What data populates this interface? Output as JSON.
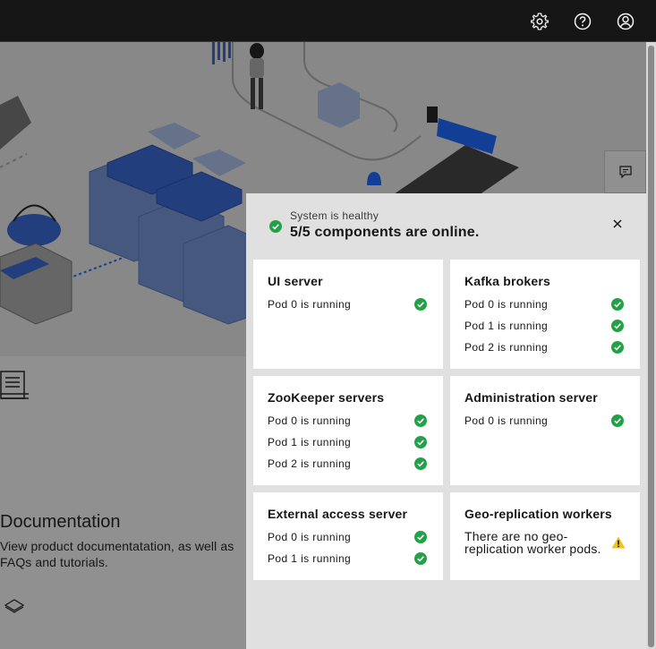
{
  "header": {
    "icons": [
      "settings-icon",
      "help-icon",
      "user-avatar-icon"
    ]
  },
  "background": {
    "documentation": {
      "title": "Documentation",
      "description": "View product documentatation, as well as FAQs and tutorials."
    }
  },
  "status_panel": {
    "subtitle": "System is healthy",
    "title": "5/5 components are online.",
    "colors": {
      "success": "#24a148",
      "warning": "#f1c21b"
    },
    "cards": [
      {
        "title": "UI server",
        "pods": [
          "Pod 0 is running"
        ]
      },
      {
        "title": "Kafka brokers",
        "pods": [
          "Pod 0 is running",
          "Pod 1 is running",
          "Pod 2 is running"
        ]
      },
      {
        "title": "ZooKeeper servers",
        "pods": [
          "Pod 0 is running",
          "Pod 1 is running",
          "Pod 2 is running"
        ]
      },
      {
        "title": "Administration server",
        "pods": [
          "Pod 0 is running"
        ]
      },
      {
        "title": "External access server",
        "pods": [
          "Pod 0 is running",
          "Pod 1 is running"
        ]
      },
      {
        "title": "Geo-replication workers",
        "pods": [],
        "note": "There are no geo-replication worker pods."
      }
    ]
  }
}
